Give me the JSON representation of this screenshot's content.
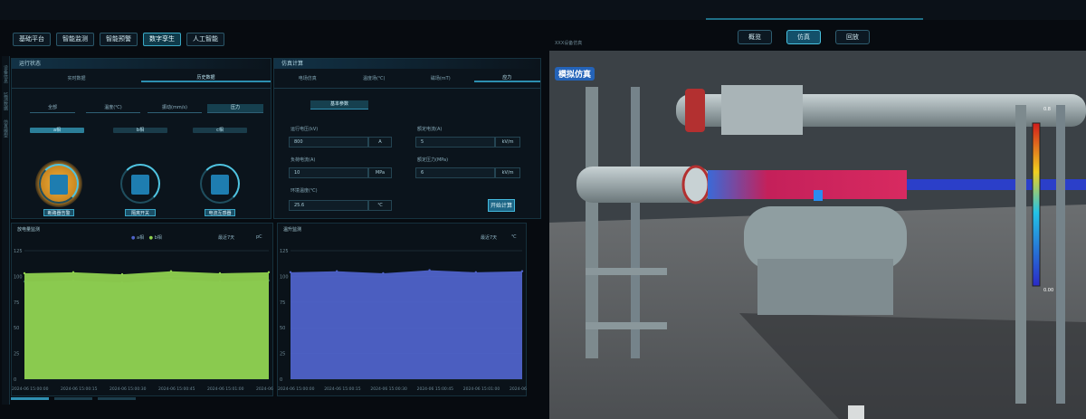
{
  "top_nav": [
    "基础平台",
    "智能监测",
    "智能预警",
    "数字孪生",
    "人工智能"
  ],
  "top_nav_active": 3,
  "right_nav": [
    "概览",
    "仿真",
    "回放"
  ],
  "right_nav_active": 1,
  "scene_caption": "XXX设备仿真",
  "scene_badge": "模拟仿真",
  "left_strip": [
    "设备信息",
    "监测数据",
    "仿真模型"
  ],
  "status_panel": {
    "title": "运行状态",
    "tabs": [
      "实时数据",
      "历史数据"
    ],
    "active_tab": 1,
    "sub_tabs": [
      "全部",
      "温度(℃)",
      "振动(mm/s)",
      "压力"
    ],
    "active_sub_tab": 3,
    "pills": [
      "a相",
      "b相",
      "c相"
    ],
    "active_pill": 0,
    "icons": [
      {
        "label": "断路器告警",
        "name": "alarm-device-icon"
      },
      {
        "label": "隔离开关",
        "name": "switch-device-icon"
      },
      {
        "label": "电流互感器",
        "name": "transformer-device-icon"
      }
    ]
  },
  "sim_panel": {
    "title": "仿真计算",
    "tabs": [
      "电场仿真",
      "温度场(℃)",
      "磁场(mT)",
      "应力"
    ],
    "active_tab": 3,
    "param_title": "基本参数",
    "fields": [
      {
        "label": "运行电压(kV)",
        "value": "800",
        "unit": "A"
      },
      {
        "label": "负荷电流(A)",
        "value": "10",
        "unit": "MPa"
      },
      {
        "label": "环境温度(℃)",
        "value": "25.6",
        "unit": "℃"
      },
      {
        "label": "额定电流(A)",
        "value": "5",
        "unit": "kV/m"
      },
      {
        "label": "额定压力(MPa)",
        "value": "6",
        "unit": "kV/m"
      }
    ],
    "calc_button": "开始计算"
  },
  "chart_left": {
    "title": "放电量监测",
    "legend": [
      "a相",
      "b相"
    ],
    "right_note": "最近7天",
    "right_unit": "pC"
  },
  "chart_right": {
    "title": "温升监测",
    "right_note": "最近7天",
    "right_unit": "℃"
  },
  "colors": {
    "accent": "#2d8fb0",
    "series_green": "#8fd14f",
    "series_blue": "#4f63c9",
    "area_left": "#2f5e4f",
    "area_right": "#1d3060"
  },
  "scale_bar": {
    "max_label": "0.8",
    "min_label": "0.00"
  },
  "chart_data": [
    {
      "type": "area",
      "title": "放电量监测",
      "xlabel": "",
      "ylabel": "",
      "x": [
        "2024-06 15:00:00",
        "2024-06 15:00:15",
        "2024-06 15:00:30",
        "2024-06 15:00:45",
        "2024-06 15:01:00",
        "2024-06 15:01:15"
      ],
      "ylim": [
        0,
        125
      ],
      "yticks": [
        0,
        25,
        50,
        75,
        100,
        125
      ],
      "series": [
        {
          "name": "a相",
          "values": [
            95,
            96,
            94,
            97,
            95,
            96
          ]
        },
        {
          "name": "b相",
          "values": [
            103,
            104,
            102,
            105,
            103,
            104
          ]
        }
      ],
      "grid": true,
      "legend": "top"
    },
    {
      "type": "area",
      "title": "温升监测",
      "xlabel": "",
      "ylabel": "",
      "x": [
        "2024-06 15:00:00",
        "2024-06 15:00:15",
        "2024-06 15:00:30",
        "2024-06 15:00:45",
        "2024-06 15:01:00",
        "2024-06 15:01:15"
      ],
      "ylim": [
        0,
        125
      ],
      "yticks": [
        0,
        25,
        50,
        75,
        100,
        125
      ],
      "series": [
        {
          "name": "",
          "values": [
            104,
            105,
            103,
            106,
            104,
            105
          ]
        }
      ],
      "grid": true,
      "legend": "none"
    }
  ]
}
